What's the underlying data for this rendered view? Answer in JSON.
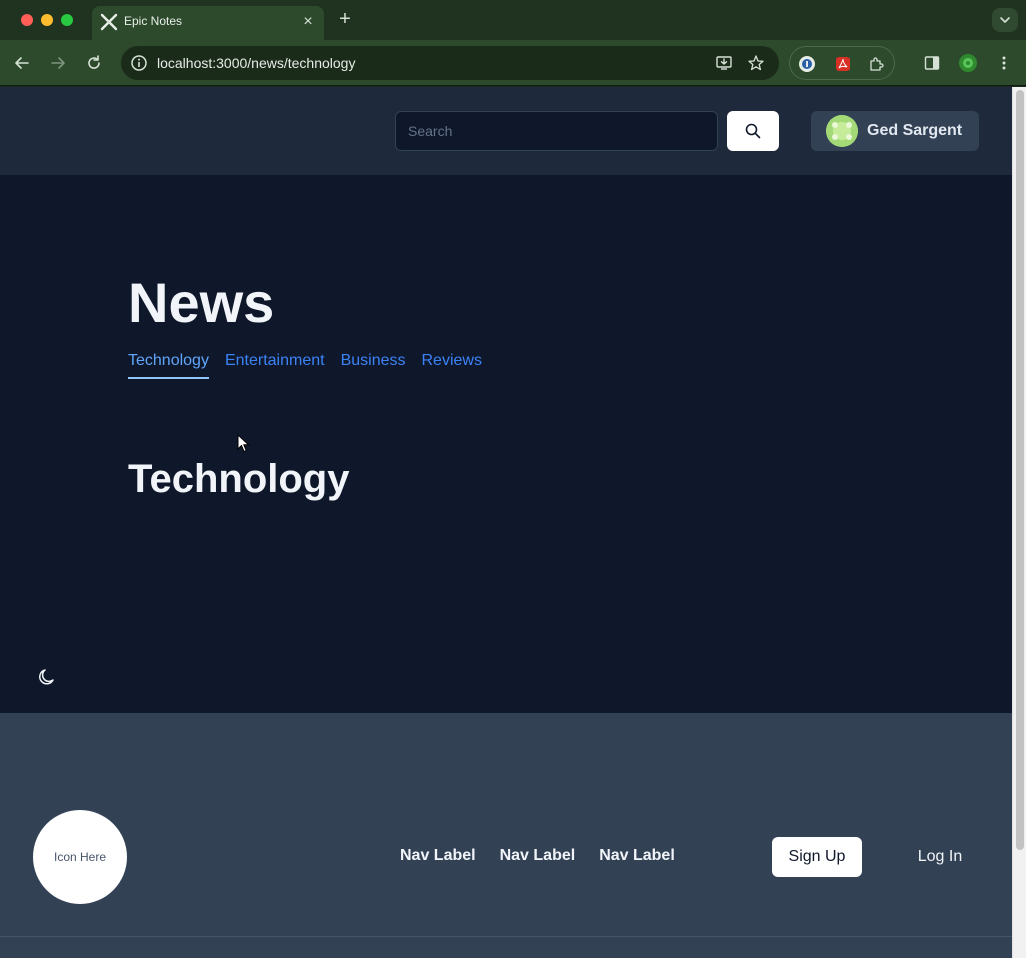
{
  "browser": {
    "tab_title": "Epic Notes",
    "url": "localhost:3000/news/technology",
    "icons": {
      "back": "arrow-left-icon",
      "forward": "arrow-right-icon",
      "reload": "reload-icon",
      "site_info": "info-icon",
      "install": "install-app-icon",
      "bookmark": "star-icon",
      "extensions": "puzzle-icon",
      "side_panel": "side-panel-icon",
      "menu": "kebab-menu-icon"
    },
    "accent_colors": {
      "frame": "#1f3320",
      "toolbar": "#2d4a2d"
    }
  },
  "header": {
    "search": {
      "placeholder": "Search",
      "icon": "search-icon"
    },
    "user": {
      "name": "Ged Sargent"
    }
  },
  "main": {
    "title": "News",
    "tabs": [
      {
        "label": "Technology",
        "active": true
      },
      {
        "label": "Entertainment",
        "active": false
      },
      {
        "label": "Business",
        "active": false
      },
      {
        "label": "Reviews",
        "active": false
      }
    ],
    "section_title": "Technology",
    "theme_toggle_icon": "moon-icon"
  },
  "footer": {
    "logo_text": "Icon Here",
    "nav": [
      {
        "label": "Nav Label"
      },
      {
        "label": "Nav Label"
      },
      {
        "label": "Nav Label"
      }
    ],
    "signup_label": "Sign Up",
    "login_label": "Log In"
  },
  "colors": {
    "page_bg": "#0f172a",
    "header_bg": "#1e293b",
    "footer_bg": "#334155",
    "link": "#3b82f6",
    "active_link": "#60a5fa"
  }
}
